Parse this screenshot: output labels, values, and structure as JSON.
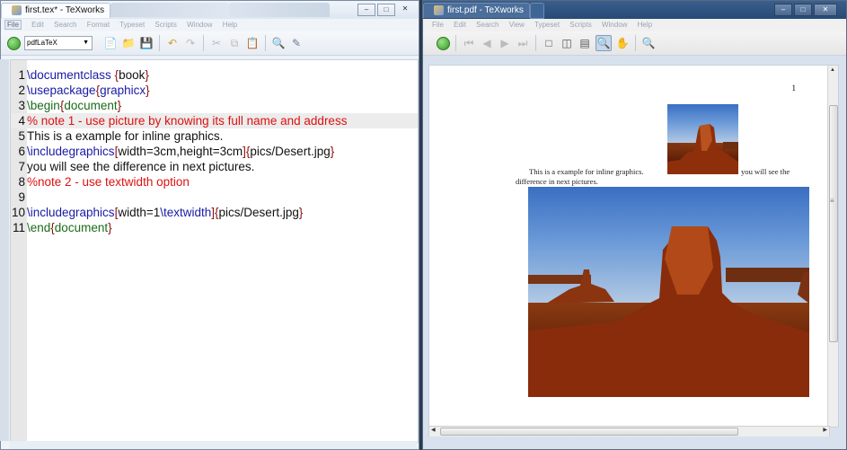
{
  "left_window": {
    "title": "first.tex* - TeXworks",
    "menu": [
      "File",
      "Edit",
      "Search",
      "Format",
      "Typeset",
      "Scripts",
      "Window",
      "Help"
    ],
    "engine": "pdfLaTeX",
    "icons": [
      "typeset-icon",
      "new-file-icon",
      "open-folder-icon",
      "save-icon",
      "undo-icon",
      "redo-icon",
      "cut-icon",
      "copy-icon",
      "paste-icon",
      "find-icon",
      "replace-icon"
    ]
  },
  "editor": {
    "lines": [
      {
        "n": "1",
        "parts": [
          {
            "t": "\\documentclass",
            "c": "kw"
          },
          {
            "t": " {",
            "c": "br"
          },
          {
            "t": "book",
            "c": "arg"
          },
          {
            "t": "}",
            "c": "br"
          }
        ]
      },
      {
        "n": "2",
        "parts": [
          {
            "t": "\\usepackage",
            "c": "kw"
          },
          {
            "t": "{",
            "c": "br"
          },
          {
            "t": "graphicx",
            "c": "kw"
          },
          {
            "t": "}",
            "c": "br"
          }
        ]
      },
      {
        "n": "3",
        "parts": [
          {
            "t": "\\begin",
            "c": "env"
          },
          {
            "t": "{",
            "c": "br"
          },
          {
            "t": "document",
            "c": "env"
          },
          {
            "t": "}",
            "c": "br"
          }
        ]
      },
      {
        "n": "4",
        "parts": [
          {
            "t": "% note 1 - use picture by knowing its full name and address",
            "c": "cm"
          }
        ],
        "highlight": true
      },
      {
        "n": "5",
        "parts": [
          {
            "t": "This is a example for inline graphics.",
            "c": "code"
          }
        ]
      },
      {
        "n": "6",
        "parts": [
          {
            "t": "\\includegraphics",
            "c": "kw"
          },
          {
            "t": "[",
            "c": "br"
          },
          {
            "t": "width=3cm,height=3cm",
            "c": "arg"
          },
          {
            "t": "]{",
            "c": "br"
          },
          {
            "t": "pics/Desert.jpg",
            "c": "arg"
          },
          {
            "t": "}",
            "c": "br"
          }
        ]
      },
      {
        "n": "7",
        "parts": [
          {
            "t": "you will see the difference in next pictures.",
            "c": "code"
          }
        ]
      },
      {
        "n": "8",
        "parts": [
          {
            "t": "%note 2 - use textwidth option",
            "c": "cm"
          }
        ]
      },
      {
        "n": "9",
        "parts": []
      },
      {
        "n": "10",
        "parts": [
          {
            "t": "\\includegraphics",
            "c": "kw"
          },
          {
            "t": "[",
            "c": "br"
          },
          {
            "t": "width=1",
            "c": "arg"
          },
          {
            "t": "\\textwidth",
            "c": "kw"
          },
          {
            "t": "]{",
            "c": "br"
          },
          {
            "t": "pics/Desert.jpg",
            "c": "arg"
          },
          {
            "t": "}",
            "c": "br"
          }
        ]
      },
      {
        "n": "11",
        "parts": [
          {
            "t": "\\end",
            "c": "env"
          },
          {
            "t": "{",
            "c": "br"
          },
          {
            "t": "document",
            "c": "env"
          },
          {
            "t": "}",
            "c": "br"
          }
        ]
      }
    ]
  },
  "right_window": {
    "title": "first.pdf - TeXworks",
    "menu": [
      "File",
      "Edit",
      "Search",
      "View",
      "Typeset",
      "Scripts",
      "Window",
      "Help"
    ],
    "icons": [
      "typeset-icon",
      "first-page-icon",
      "prev-page-icon",
      "next-page-icon",
      "last-page-icon",
      "actual-size-icon",
      "fit-width-icon",
      "fit-window-icon",
      "magnify-icon",
      "hand-icon",
      "find-icon"
    ]
  },
  "pdf": {
    "page_number": "1",
    "line1_before": "This is a example for inline graphics.",
    "line1_after": "you will see the",
    "line2": "difference in next pictures."
  }
}
